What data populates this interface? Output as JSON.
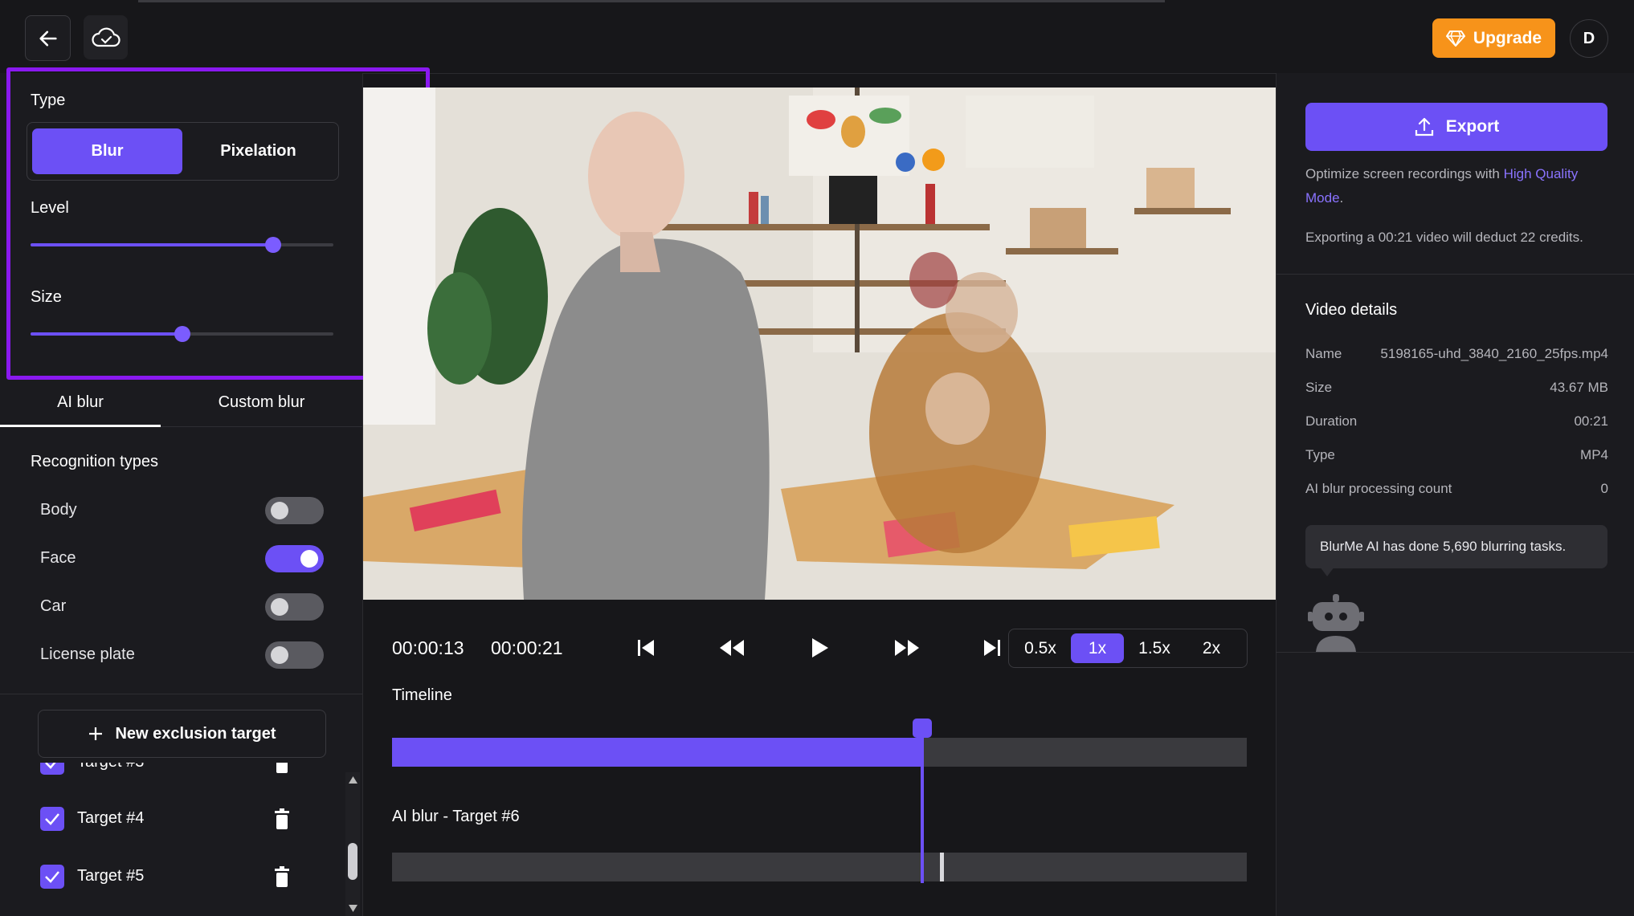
{
  "topbar": {
    "back_icon": "arrow-left-icon",
    "cloud_icon": "cloud-check-icon",
    "upgrade_label": "Upgrade",
    "avatar_initial": "D",
    "accent": "#f7931a"
  },
  "settings": {
    "type_label": "Type",
    "type_options": [
      "Blur",
      "Pixelation"
    ],
    "type_selected": "Blur",
    "level_label": "Level",
    "level_value": 0.8,
    "size_label": "Size",
    "size_value": 0.5
  },
  "tabs": [
    "AI blur",
    "Custom blur"
  ],
  "active_tab": "AI blur",
  "recognition": {
    "title": "Recognition types",
    "items": [
      {
        "label": "Body",
        "on": false
      },
      {
        "label": "Face",
        "on": true
      },
      {
        "label": "Car",
        "on": false
      },
      {
        "label": "License plate",
        "on": false
      }
    ]
  },
  "exclusion": {
    "new_label": "New exclusion target",
    "targets": [
      {
        "label": "Target #3",
        "checked": true
      },
      {
        "label": "Target #4",
        "checked": true
      },
      {
        "label": "Target #5",
        "checked": true
      }
    ]
  },
  "player": {
    "current_time": "00:00:13",
    "total_time": "00:00:21",
    "speeds": [
      "0.5x",
      "1x",
      "1.5x",
      "2x"
    ],
    "speed_selected": "1x",
    "progress": 0.62,
    "timeline_label": "Timeline",
    "track_label": "AI blur - Target #6"
  },
  "right": {
    "export_label": "Export",
    "hq_text_prefix": "Optimize screen recordings with ",
    "hq_link": "High Quality Mode",
    "hq_text_suffix": ".",
    "credits_note": "Exporting a 00:21 video will deduct 22 credits.",
    "details_title": "Video details",
    "details": [
      {
        "key": "Name",
        "value": "5198165-uhd_3840_2160_25fps.mp4"
      },
      {
        "key": "Size",
        "value": "43.67 MB"
      },
      {
        "key": "Duration",
        "value": "00:21"
      },
      {
        "key": "Type",
        "value": "MP4"
      },
      {
        "key": "AI blur processing count",
        "value": "0"
      }
    ],
    "bubble_text": "BlurMe AI has done 5,690 blurring tasks.",
    "robot_icon": "robot-icon"
  },
  "colors": {
    "brand": "#6c50f5",
    "highlight": "#8a19f0"
  }
}
